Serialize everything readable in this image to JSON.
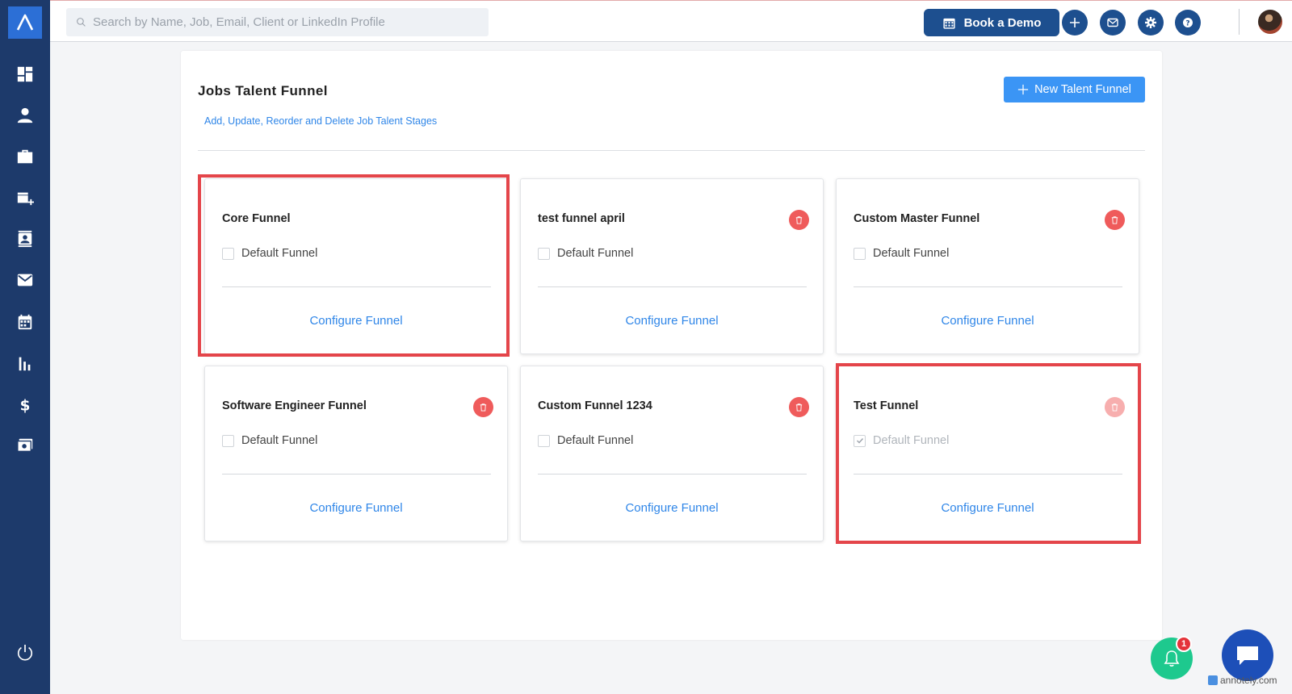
{
  "search": {
    "placeholder": "Search by Name, Job, Email, Client or LinkedIn Profile"
  },
  "header": {
    "book_demo_label": "Book a Demo"
  },
  "page": {
    "title": "Jobs Talent Funnel",
    "subtitle": "Add, Update, Reorder and Delete Job Talent Stages",
    "new_button_label": "New Talent Funnel"
  },
  "funnels": [
    {
      "name": "Core Funnel",
      "default_label": "Default Funnel",
      "configure_label": "Configure Funnel",
      "deletable": false,
      "is_default": false,
      "highlighted": true
    },
    {
      "name": "test funnel april",
      "default_label": "Default Funnel",
      "configure_label": "Configure Funnel",
      "deletable": true,
      "is_default": false,
      "highlighted": false
    },
    {
      "name": "Custom Master Funnel",
      "default_label": "Default Funnel",
      "configure_label": "Configure Funnel",
      "deletable": true,
      "is_default": false,
      "highlighted": false
    },
    {
      "name": "Software Engineer Funnel",
      "default_label": "Default Funnel",
      "configure_label": "Configure Funnel",
      "deletable": true,
      "is_default": false,
      "highlighted": false
    },
    {
      "name": "Custom Funnel 1234",
      "default_label": "Default Funnel",
      "configure_label": "Configure Funnel",
      "deletable": true,
      "is_default": false,
      "highlighted": false
    },
    {
      "name": "Test Funnel",
      "default_label": "Default Funnel",
      "configure_label": "Configure Funnel",
      "deletable": true,
      "is_default": true,
      "highlighted": true
    }
  ],
  "notifications": {
    "badge_count": "1"
  },
  "watermark": {
    "text": "annotely.com"
  },
  "colors": {
    "sidebar": "#1d3a6b",
    "primary": "#3b95f5",
    "link": "#2f86e8",
    "delete": "#ef5b5b",
    "highlight": "#e4454a"
  }
}
